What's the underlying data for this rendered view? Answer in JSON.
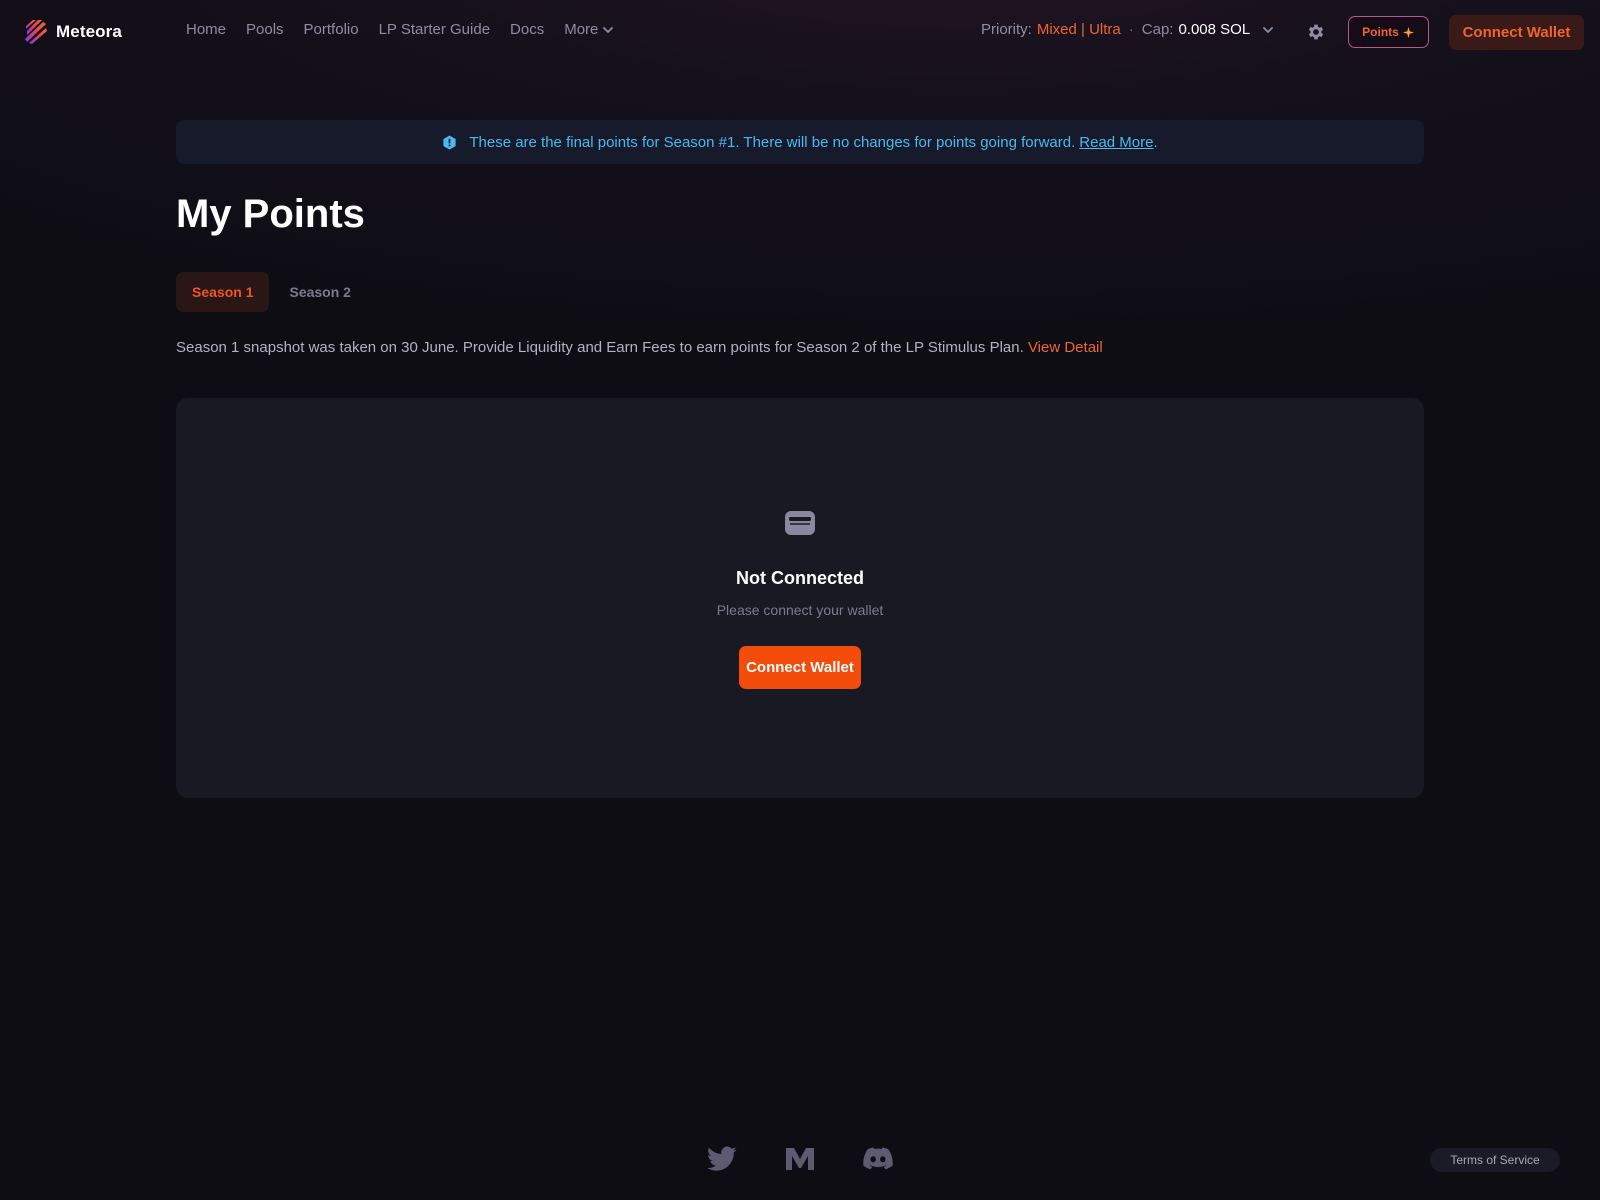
{
  "brand": {
    "name": "Meteora",
    "logo_icon": "meteora-logo-icon"
  },
  "nav": {
    "items": [
      {
        "label": "Home"
      },
      {
        "label": "Pools"
      },
      {
        "label": "Portfolio"
      },
      {
        "label": "LP Starter Guide"
      },
      {
        "label": "Docs"
      }
    ],
    "more_label": "More"
  },
  "priority": {
    "label": "Priority:",
    "value": "Mixed | Ultra",
    "separator": "·",
    "cap_label": "Cap:",
    "cap_value": "0.008 SOL"
  },
  "header_actions": {
    "points_label": "Points",
    "connect_label": "Connect Wallet"
  },
  "banner": {
    "text": "These are the final points for Season #1. There will be no changes for points going forward.",
    "link": "Read More",
    "trailing": "."
  },
  "page": {
    "title": "My Points",
    "tabs": [
      {
        "label": "Season 1",
        "active": true
      },
      {
        "label": "Season 2",
        "active": false
      }
    ],
    "description": "Season 1 snapshot was taken on 30 June. Provide Liquidity and Earn Fees to earn points for Season 2 of the LP Stimulus Plan.",
    "description_link": "View Detail"
  },
  "empty_state": {
    "icon": "wallet-icon",
    "title": "Not Connected",
    "subtitle": "Please connect your wallet",
    "button_label": "Connect Wallet"
  },
  "footer": {
    "social_icons": [
      "twitter-icon",
      "medium-icon",
      "discord-icon"
    ],
    "terms_label": "Terms of Service"
  },
  "colors": {
    "accent": "#f44c0a",
    "accent_text": "#f0642f",
    "info": "#4bb8f0",
    "background": "#0e0d14",
    "card": "#191923"
  }
}
